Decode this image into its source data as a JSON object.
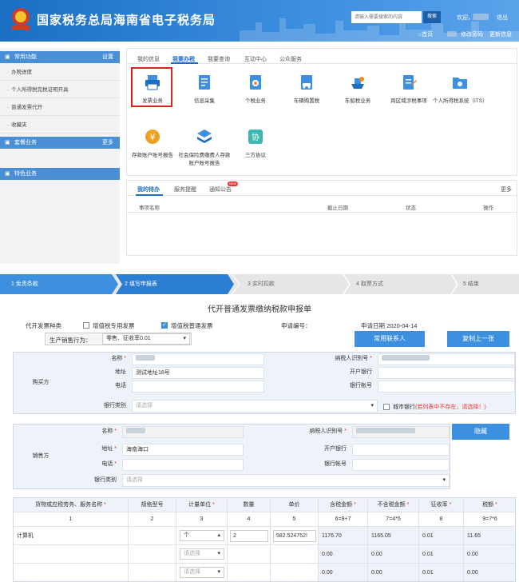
{
  "header": {
    "title": "国家税务总局海南省电子税务局",
    "search_placeholder": "请输入需要搜索的内容",
    "search_button": "搜索",
    "welcome": "欢迎，",
    "logout": "退出",
    "home": "首页",
    "change_password": "修改密码",
    "update_info": "更新信息"
  },
  "sidebar": {
    "section1": {
      "title": "常用功能",
      "action": "设置"
    },
    "items": [
      "办税进度",
      "个人所得税完税证明开具",
      "普通发票代开",
      "收藏夹"
    ],
    "section2": {
      "title": "套餐业务",
      "action": "更多"
    },
    "section3": {
      "title": "特色业务"
    }
  },
  "main": {
    "tabs": [
      "我的信息",
      "我要办税",
      "我要查询",
      "互动中心",
      "公众服务"
    ],
    "functions_row1": [
      "发票业务",
      "信息采集",
      "个税业务",
      "车辆购置税",
      "车船税业务",
      "跨区域涉税事项",
      "个人所得税系统（ITS）"
    ],
    "functions_row2": [
      "存款账户账号报告",
      "社会保险费缴费人存款账户账号报告",
      "三方协议"
    ]
  },
  "todo": {
    "tabs": [
      "我的待办",
      "服务提醒",
      "通知公告"
    ],
    "new_badge": "NEW",
    "more": "更多",
    "columns": [
      "事项名称",
      "截止日期",
      "状态",
      "操作"
    ]
  },
  "steps": [
    "1 免责条款",
    "2 填写申报表",
    "3 实时扣款",
    "4 取票方式",
    "5 结束"
  ],
  "form": {
    "title": "代开普通发票缴纳税款申报单",
    "invoice_type_label": "代开发票种类",
    "opt_special": "增值税专用发票",
    "opt_normal": "增值税普通发票",
    "apply_no_label": "申请编号：",
    "apply_date": "申请日期 2020-04-14",
    "sales_behavior_label": "生产销售行为：",
    "sales_behavior_value": "零售、征收率0.01",
    "btn_contacts": "常用联系人",
    "btn_copy": "复制上一张",
    "buyer": {
      "section": "购买方",
      "name": "名称",
      "address": "地址",
      "address_value": "测试地址18号",
      "phone": "电话",
      "bank_type": "银行类别",
      "bank_placeholder": "请选择",
      "tax_id": "纳税人识别号",
      "open_bank": "开户银行",
      "account": "银行帐号",
      "city_bank": "城市银行",
      "city_bank_note": "(若列表中不存在，请选择！)"
    },
    "seller": {
      "section": "销售方",
      "name": "名称",
      "address": "地址",
      "address_value": "海南海口",
      "phone": "电话",
      "bank_type": "银行类别",
      "bank_placeholder": "请选择",
      "tax_id": "纳税人识别号",
      "open_bank": "开户银行",
      "account": "银行帐号",
      "hide_btn": "隐藏"
    },
    "goods_table": {
      "columns": [
        "货物或应税劳务、服务名称",
        "规格型号",
        "计量单位",
        "数量",
        "单价",
        "含税金额",
        "不含税金额",
        "征收率",
        "税额"
      ],
      "required": [
        true,
        false,
        true,
        false,
        false,
        true,
        true,
        true,
        true
      ],
      "index": [
        "1",
        "2",
        "3",
        "4",
        "5",
        "6=9+7",
        "7=4*5",
        "8",
        "9=7*6"
      ],
      "rows": [
        [
          "计算机",
          "",
          "个",
          "2",
          "582.524752!",
          "1176.70",
          "1165.05",
          "0.01",
          "11.65"
        ],
        [
          "",
          "",
          "请选择",
          "",
          "",
          "0.00",
          "0.00",
          "0.01",
          "0.00"
        ],
        [
          "",
          "",
          "请选择",
          "",
          "",
          "0.00",
          "0.00",
          "0.01",
          "0.00"
        ]
      ]
    }
  }
}
